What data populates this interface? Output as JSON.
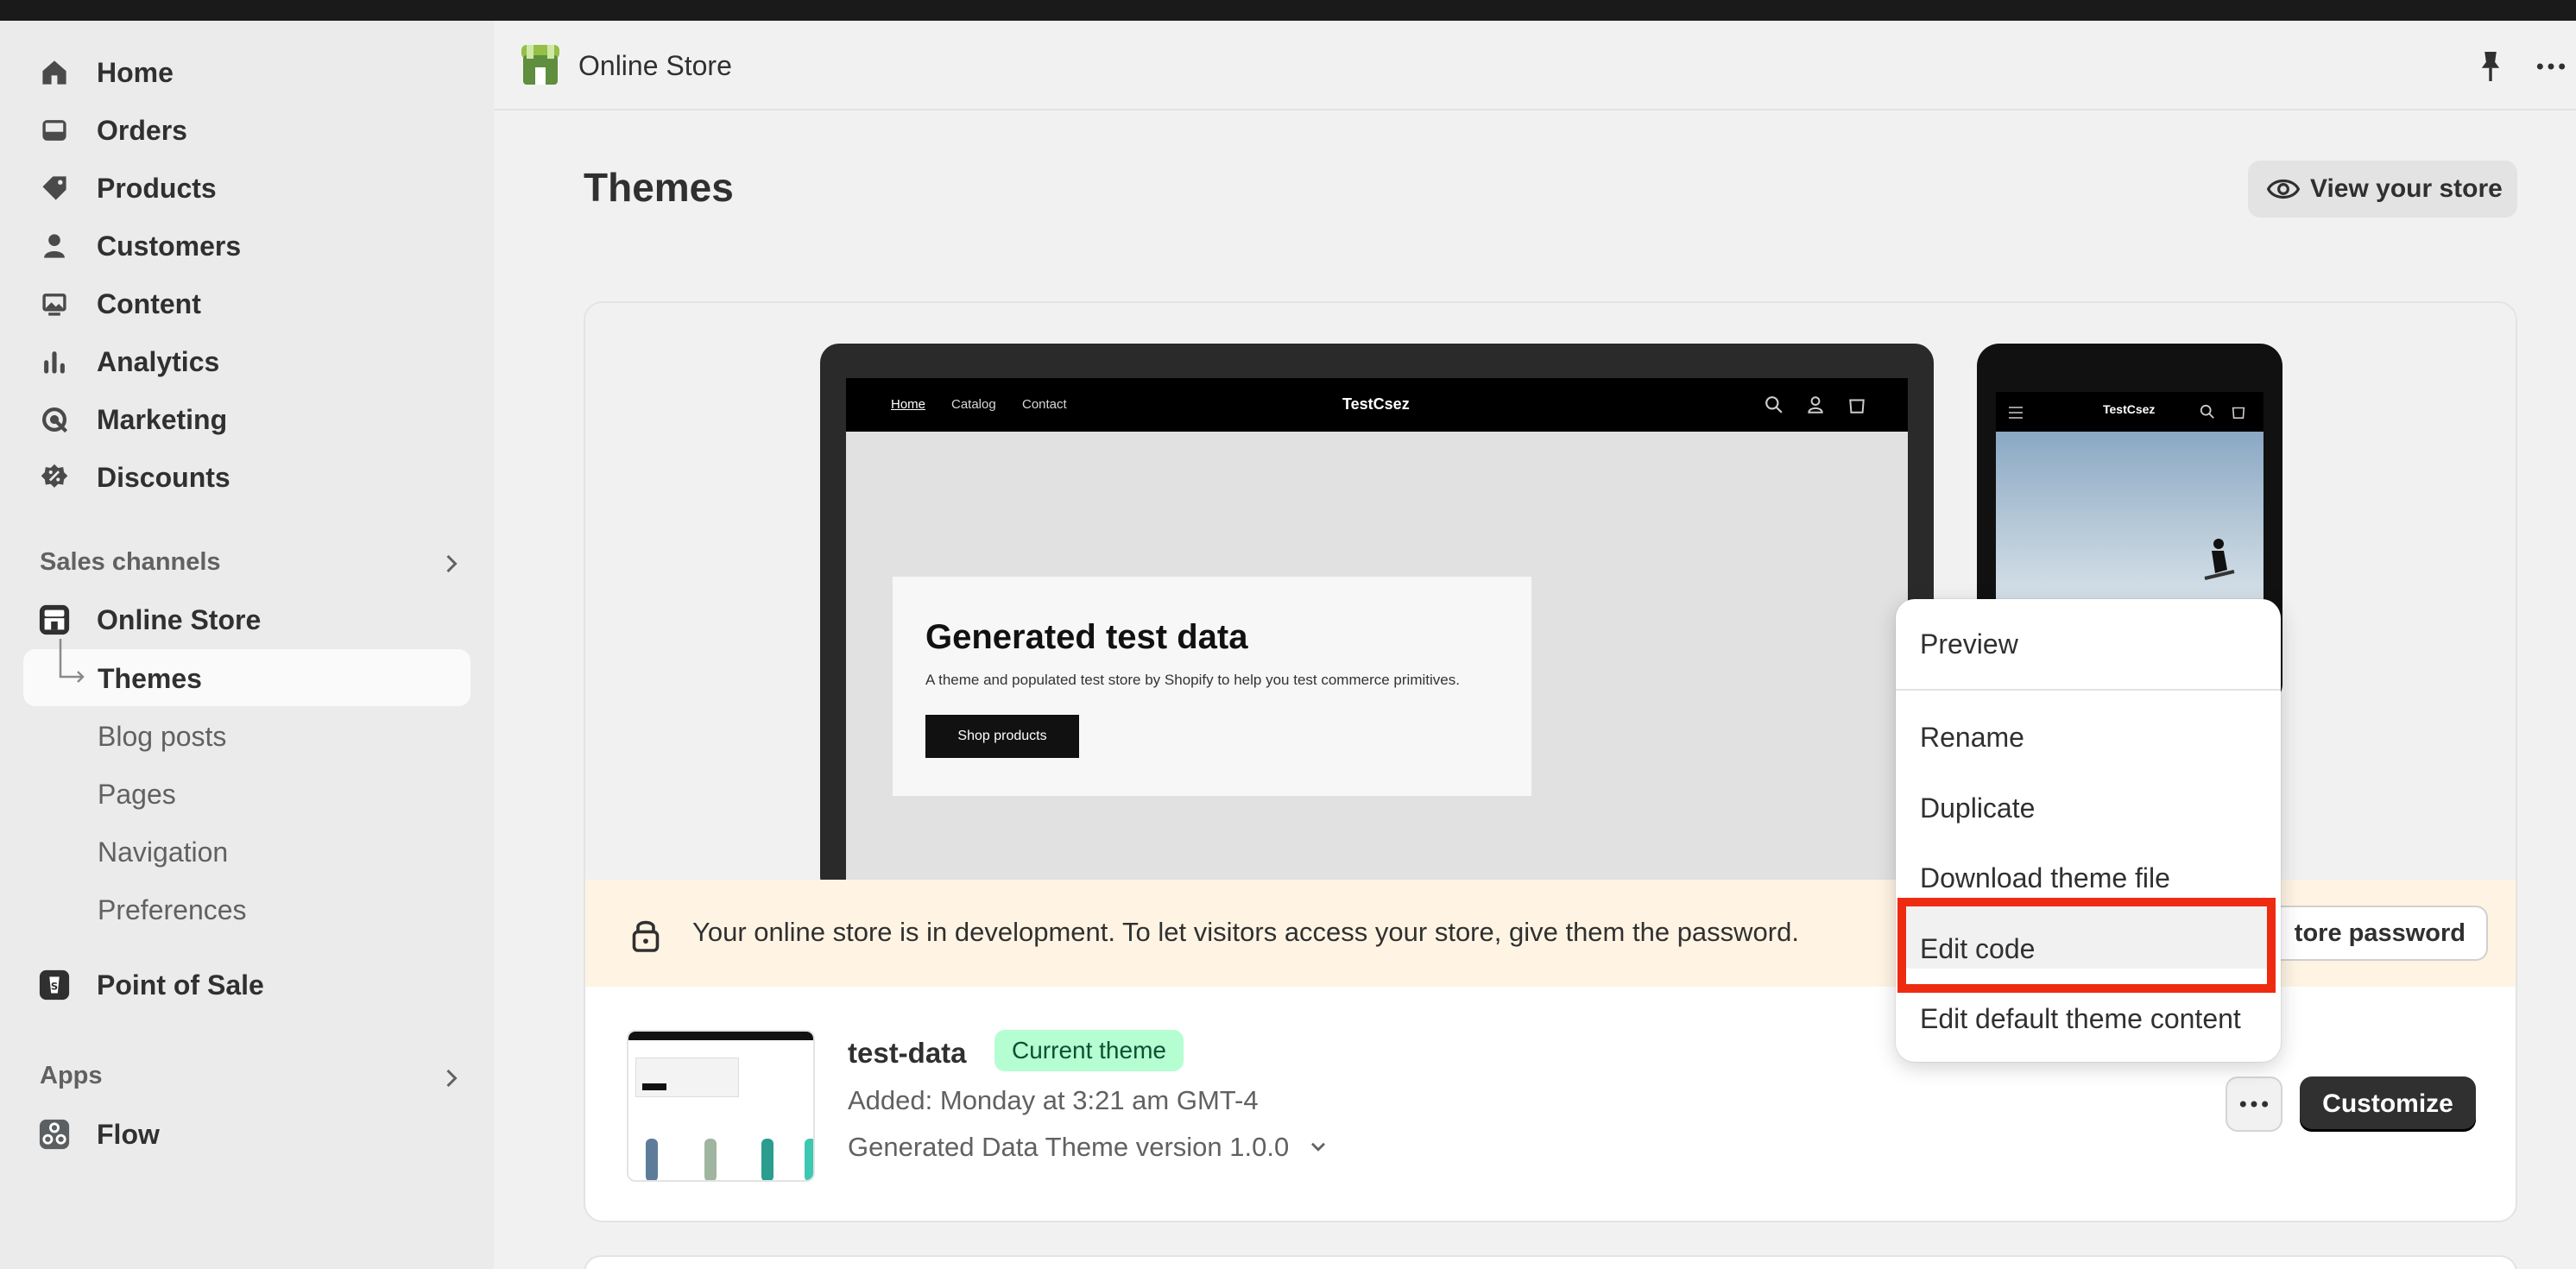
{
  "sidebar": {
    "main_items": [
      {
        "label": "Home",
        "icon": "home-icon"
      },
      {
        "label": "Orders",
        "icon": "inbox-icon"
      },
      {
        "label": "Products",
        "icon": "tag-icon"
      },
      {
        "label": "Customers",
        "icon": "person-icon"
      },
      {
        "label": "Content",
        "icon": "image-icon"
      },
      {
        "label": "Analytics",
        "icon": "bar-chart-icon"
      },
      {
        "label": "Marketing",
        "icon": "target-icon"
      },
      {
        "label": "Discounts",
        "icon": "discount-icon"
      }
    ],
    "sales_channels_label": "Sales channels",
    "online_store_label": "Online Store",
    "online_store_subitems": [
      "Themes",
      "Blog posts",
      "Pages",
      "Navigation",
      "Preferences"
    ],
    "pos_label": "Point of Sale",
    "apps_label": "Apps",
    "flow_label": "Flow"
  },
  "header": {
    "title": "Online Store"
  },
  "page": {
    "title": "Themes",
    "view_store_label": "View your store"
  },
  "preview": {
    "nav_links": [
      "Home",
      "Catalog",
      "Contact"
    ],
    "store_name": "TestCsez",
    "hero_title": "Generated test data",
    "hero_subtitle": "A theme and populated test store by Shopify to help you test commerce primitives.",
    "hero_button": "Shop products"
  },
  "banner": {
    "text": "Your online store is in development. To let visitors access your store, give them the password.",
    "button_label": "tore password"
  },
  "theme": {
    "name": "test-data",
    "badge": "Current theme",
    "added": "Added: Monday at 3:21 am GMT-4",
    "version": "Generated Data Theme version 1.0.0",
    "customize_label": "Customize"
  },
  "menu": {
    "items": [
      "Preview",
      "Rename",
      "Duplicate",
      "Download theme file",
      "Edit code",
      "Edit default theme content"
    ]
  },
  "colors": {
    "highlight": "#ee2b10",
    "badge_bg": "#b4fed2",
    "banner_bg": "#fff4e4"
  }
}
